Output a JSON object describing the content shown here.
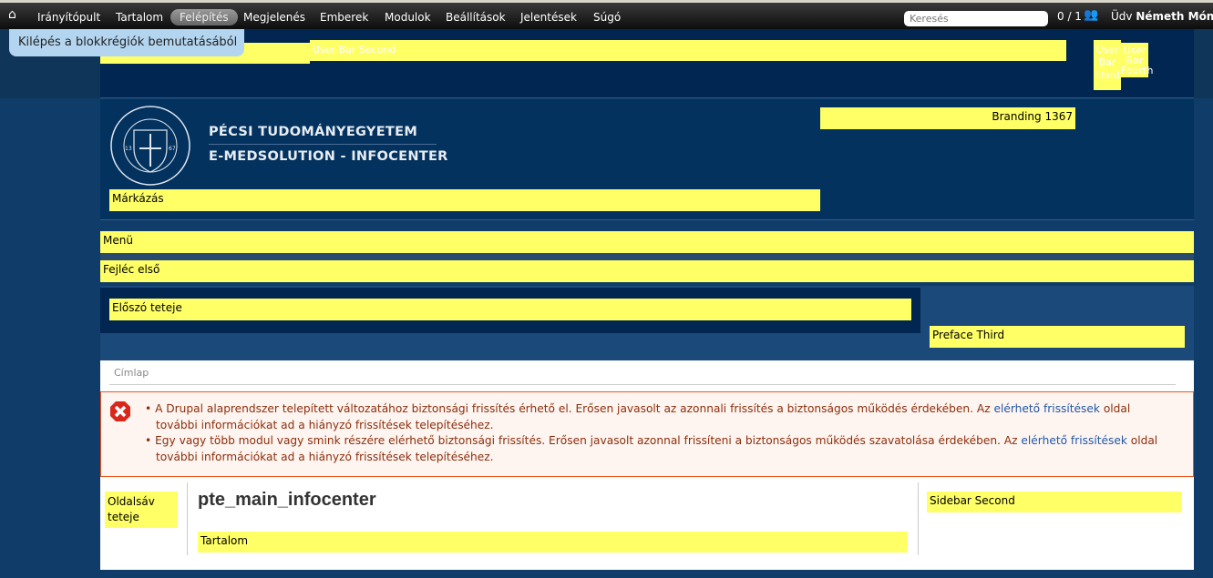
{
  "toolbar": {
    "items": [
      "Irányítópult",
      "Tartalom",
      "Felépítés",
      "Megjelenés",
      "Emberek",
      "Modulok",
      "Beállítások",
      "Jelentések",
      "Súgó"
    ],
    "active": "Felépítés",
    "search_placeholder": "Keresés",
    "user_count": "0 / 1",
    "greeting": "Üdv",
    "user_name": "Németh Mónik"
  },
  "exit_demo": "Kilépés a blokkrégiók bemutatásából",
  "regions": {
    "user_first": "User Bar First",
    "user_second": "User Bar Second",
    "user_third": "User Bar Third",
    "user_fourth": "User Bar Fourth",
    "branding": "Branding 1367",
    "markazas": "Márkázás",
    "menu": "Menü",
    "header_first": "Fejléc első",
    "preface_first": "Előszó teteje",
    "preface_third": "Preface Third",
    "sidebar_first": "Oldalsáv teteje",
    "content": "Tartalom",
    "sidebar_second": "Sidebar Second"
  },
  "logo": {
    "line1": "PÉCSI TUDOMÁNYEGYETEM",
    "line2": "E-MEDSOLUTION - INFOCENTER",
    "seal_text": "UNIVERSITAS QUINQUEECCLESIENSIS 1367"
  },
  "breadcrumb": "Címlap",
  "messages": [
    {
      "pre": "A Drupal alaprendszer telepített változatához biztonsági frissítés érhető el. Erősen javasolt az azonnali frissítés a biztonságos működés érdekében. Az ",
      "link": "elérhető frissítések",
      "post": " oldal további információkat ad a hiányzó frissítések telepítéséhez."
    },
    {
      "pre": "Egy vagy több modul vagy smink részére elérhető biztonsági frissítés. Erősen javasolt azonnal frissíteni a biztonságos működés szavatolása érdekében. Az ",
      "link": "elérhető frissítések",
      "post": " oldal további információkat ad a hiányzó frissítések telepítéséhez."
    }
  ],
  "page_title": "pte_main_infocenter",
  "colors": {
    "toolbar": "#111111",
    "navy": "#002651",
    "yellow": "#ffff66",
    "error_border": "#ed541d",
    "error_text": "#8c2e0b",
    "link": "#2357a5"
  }
}
